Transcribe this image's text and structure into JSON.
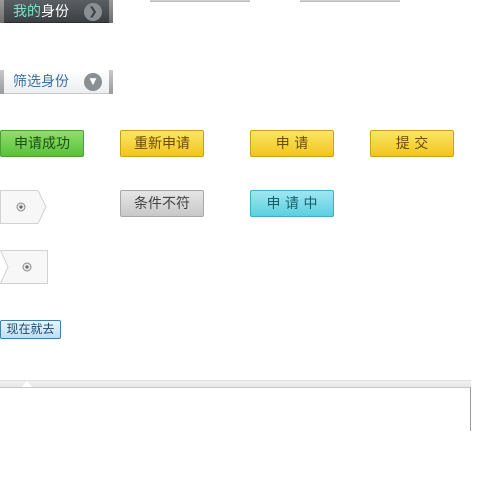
{
  "identity_tab": {
    "label_accent": "我的",
    "label_rest": "身份",
    "icon": "chevron-right-circle-icon"
  },
  "filter_tab": {
    "label": "筛选身份",
    "icon": "chevron-down-circle-icon"
  },
  "buttons": {
    "apply_success": "申请成功",
    "reapply": "重新申请",
    "apply": "申 请",
    "submit": "提 交",
    "not_eligible": "条件不符",
    "applying": "申 请 中",
    "go_now": "现在就去"
  },
  "chips": {
    "step_a_icon": "radio-dot-icon",
    "step_b_icon": "radio-dot-icon"
  },
  "colors": {
    "success_green": "#5bbf3d",
    "action_yellow": "#f2c51d",
    "disabled_gray": "#c8c8c8",
    "pending_cyan": "#5ccfe0",
    "link_blue": "#3a6ea5"
  }
}
